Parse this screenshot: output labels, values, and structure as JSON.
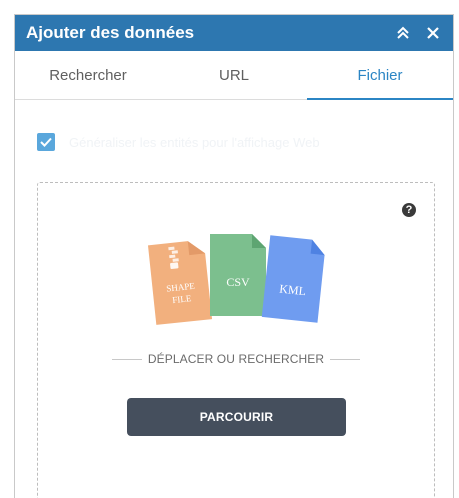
{
  "header": {
    "title": "Ajouter des données",
    "collapse_icon": "double-chevron-up-icon",
    "close_icon": "close-icon"
  },
  "tabs": [
    {
      "label": "Rechercher",
      "active": false
    },
    {
      "label": "URL",
      "active": false
    },
    {
      "label": "Fichier",
      "active": true
    }
  ],
  "options": {
    "generalize_label": "Généraliser les entités pour l'affichage Web",
    "checked": true
  },
  "dropzone": {
    "help_icon": "help-icon",
    "file_types": [
      {
        "label_line1": "SHAPE",
        "label_line2": "FILE",
        "color": "#f2b07e"
      },
      {
        "label_line1": "CSV",
        "label_line2": "",
        "color": "#7cbf8e"
      },
      {
        "label_line1": "KML",
        "label_line2": "",
        "color": "#6f9cf0"
      }
    ],
    "instruction": "DÉPLACER OU RECHERCHER",
    "browse_label": "PARCOURIR"
  },
  "colors": {
    "header_bg": "#2d77b0",
    "accent": "#2b85c4",
    "button_bg": "#454f5d"
  }
}
